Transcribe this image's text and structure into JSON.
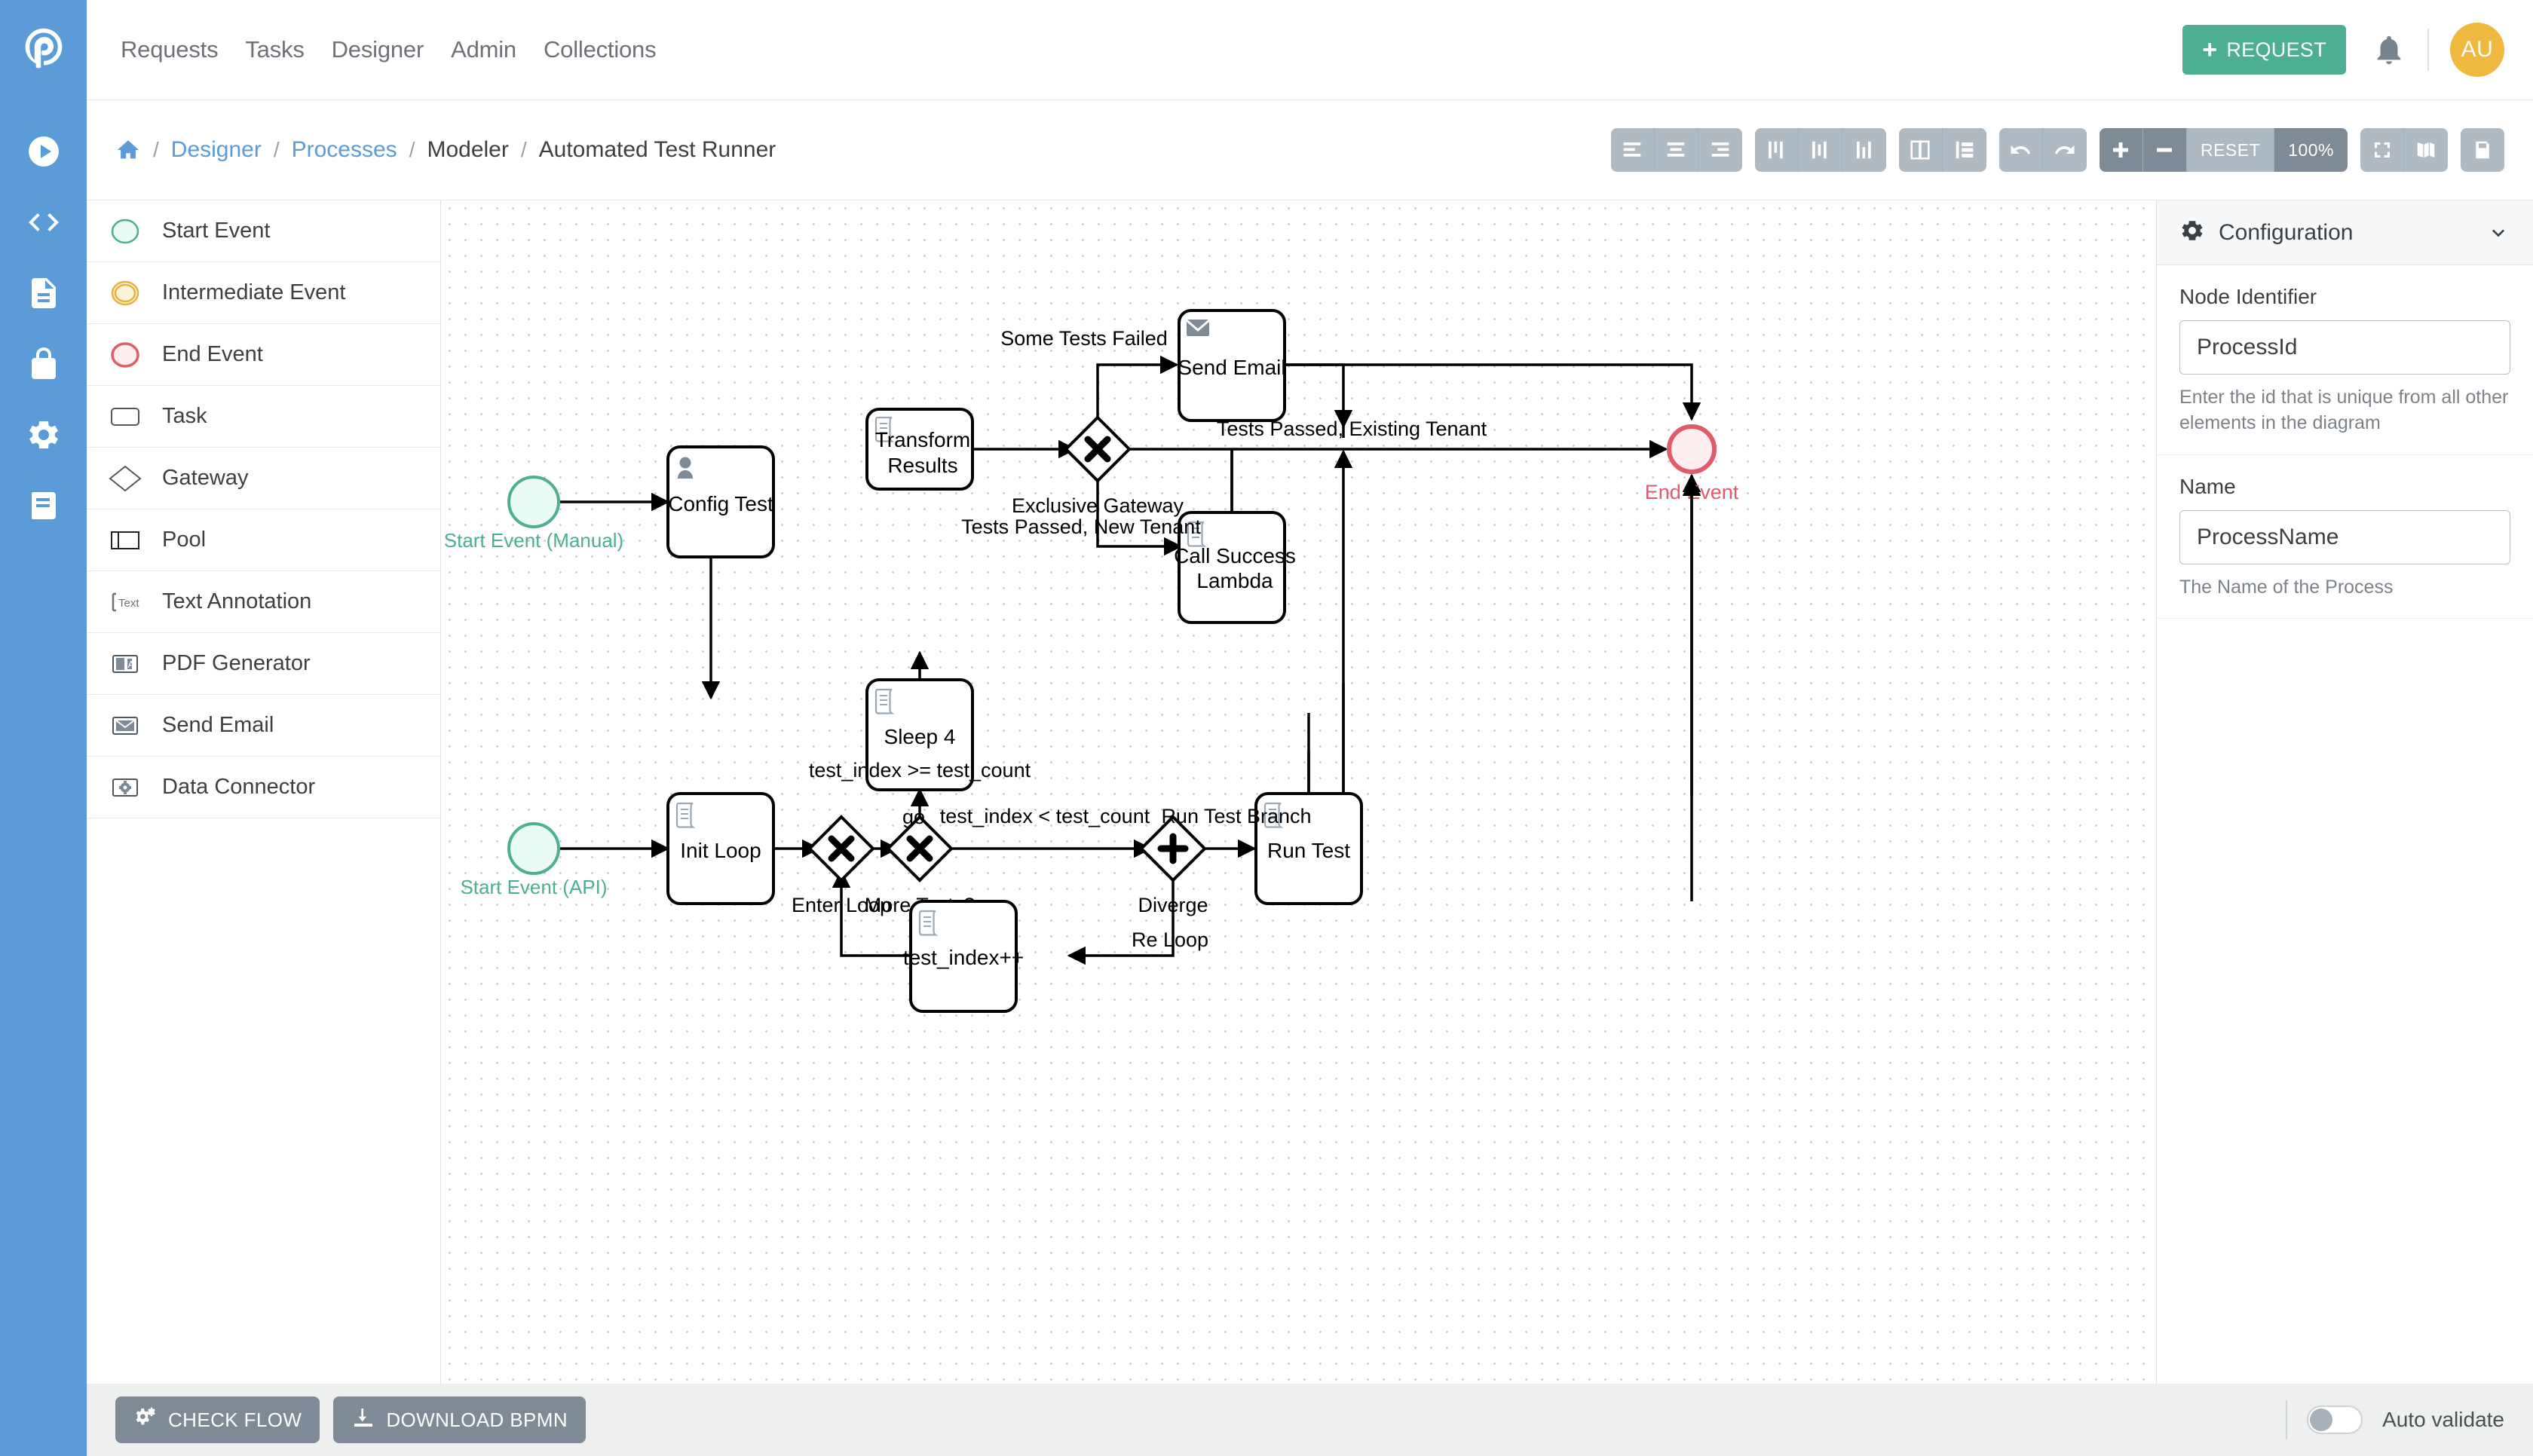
{
  "topnav": {
    "logo_icon": "processmaker-logo-icon",
    "links": [
      "Requests",
      "Tasks",
      "Designer",
      "Admin",
      "Collections"
    ],
    "request_button": "REQUEST",
    "request_plus": "+",
    "bell_icon": "bell-icon",
    "avatar_initials": "AU",
    "accent_blue": "#5a9bd8",
    "accent_green": "#4caf93",
    "avatar_color": "#efb940"
  },
  "rail": {
    "icons": [
      "play-circle-icon",
      "code-icon",
      "document-icon",
      "lock-icon",
      "gear-icon",
      "book-icon"
    ]
  },
  "breadcrumb": {
    "home_icon": "home-icon",
    "separator": "/",
    "items": [
      {
        "label": "Designer",
        "link": true
      },
      {
        "label": "Processes",
        "link": true
      },
      {
        "label": "Modeler",
        "link": false
      },
      {
        "label": "Automated Test Runner",
        "link": false
      }
    ]
  },
  "toolbar": {
    "align_group": [
      "align-left-icon",
      "align-center-icon",
      "align-right-icon"
    ],
    "align_vert_group": [
      "align-top-icon",
      "align-middle-icon",
      "align-bottom-icon"
    ],
    "distribute_group": [
      "distribute-horizontal-icon",
      "distribute-vertical-icon"
    ],
    "history_group": [
      "undo-icon",
      "redo-icon"
    ],
    "zoom_in": "+",
    "zoom_out": "−",
    "reset_label": "RESET",
    "zoom_level": "100%",
    "fit_icon": "fit-screen-icon",
    "minimap_icon": "minimap-icon",
    "save_icon": "save-icon"
  },
  "palette": {
    "items": [
      {
        "label": "Start Event",
        "icon": "start-event-icon"
      },
      {
        "label": "Intermediate Event",
        "icon": "intermediate-event-icon"
      },
      {
        "label": "End Event",
        "icon": "end-event-icon"
      },
      {
        "label": "Task",
        "icon": "task-icon"
      },
      {
        "label": "Gateway",
        "icon": "gateway-icon"
      },
      {
        "label": "Pool",
        "icon": "pool-icon"
      },
      {
        "label": "Text Annotation",
        "icon": "text-annotation-icon"
      },
      {
        "label": "PDF Generator",
        "icon": "pdf-generator-icon"
      },
      {
        "label": "Send Email",
        "icon": "send-email-icon"
      },
      {
        "label": "Data Connector",
        "icon": "data-connector-icon"
      }
    ]
  },
  "diagram": {
    "nodes": [
      {
        "id": "start_manual",
        "type": "start-event",
        "label": "Start Event (Manual)"
      },
      {
        "id": "start_api",
        "type": "start-event",
        "label": "Start Event (API)"
      },
      {
        "id": "config_test",
        "type": "user-task",
        "label": "Config Test"
      },
      {
        "id": "init_loop",
        "type": "script-task",
        "label": "Init Loop"
      },
      {
        "id": "enter_loop",
        "type": "exclusive-gateway",
        "label": "Enter Loop"
      },
      {
        "id": "more_tests",
        "type": "exclusive-gateway",
        "label": "More Tests?"
      },
      {
        "id": "diverge",
        "type": "parallel-gateway",
        "label": "Diverge"
      },
      {
        "id": "run_test",
        "type": "script-task",
        "label": "Run Test"
      },
      {
        "id": "test_index_inc",
        "type": "script-task",
        "label": "test_index++"
      },
      {
        "id": "sleep4",
        "type": "script-task",
        "label": "Sleep 4"
      },
      {
        "id": "transform_results",
        "type": "script-task",
        "label": "Transform Results"
      },
      {
        "id": "exclusive_gateway",
        "type": "exclusive-gateway",
        "label": "Exclusive Gateway"
      },
      {
        "id": "send_email",
        "type": "email-task",
        "label": "Send Email"
      },
      {
        "id": "call_success_lambda",
        "type": "script-task",
        "label": "Call Success Lambda"
      },
      {
        "id": "end_event",
        "type": "end-event",
        "label": "End Event"
      }
    ],
    "edge_labels": [
      "go",
      "test_index < test_count",
      "test_index >= test_count",
      "Run Test Branch",
      "Re Loop",
      "Some Tests Failed",
      "Tests Passed, Existing Tenant",
      "Tests Passed, New Tenant"
    ],
    "node_text": {
      "start_manual": "Start Event (Manual)",
      "start_api": "Start Event (API)",
      "config_test": "Config Test",
      "init_loop": "Init Loop",
      "enter_loop": "Enter Loop",
      "more_tests": "More Tests?",
      "diverge": "Diverge",
      "run_test": "Run Test",
      "test_index_inc": "test_index++",
      "sleep4": "Sleep 4",
      "transform_l1": "Transform",
      "transform_l2": "Results",
      "exclusive_gateway": "Exclusive Gateway",
      "send_email": "Send Email",
      "lambda_l1": "Call Success",
      "lambda_l2": "Lambda",
      "end_event": "End Event"
    },
    "labels": {
      "go": "go",
      "test_index_lt": "test_index < test_count",
      "test_index_gte": "test_index >= test_count",
      "run_test_branch": "Run Test Branch",
      "re_loop": "Re Loop",
      "some_tests_failed": "Some Tests Failed",
      "tests_passed_existing": "Tests Passed, Existing Tenant",
      "tests_passed_new": "Tests Passed, New Tenant"
    },
    "colors": {
      "start_event_stroke": "#4caf93",
      "start_event_fill": "#eafaf4",
      "end_event_stroke": "#e05c6a",
      "end_event_fill": "#fdeef0",
      "intermediate_stroke": "#e8b33c",
      "intermediate_fill": "#fdf3da",
      "task_stroke": "#000000",
      "flow_stroke": "#000000"
    }
  },
  "config_panel": {
    "title": "Configuration",
    "gear_icon": "gear-icon",
    "collapse_icon": "chevron-down-icon",
    "fields": [
      {
        "label": "Node Identifier",
        "value": "ProcessId",
        "help": "Enter the id that is unique from all other elements in the diagram"
      },
      {
        "label": "Name",
        "value": "ProcessName",
        "help": "The Name of the Process"
      }
    ]
  },
  "bottombar": {
    "check_flow": "CHECK FLOW",
    "check_flow_icon": "cogs-icon",
    "download_bpmn": "DOWNLOAD BPMN",
    "download_icon": "download-icon",
    "auto_validate": "Auto validate",
    "auto_validate_on": false
  }
}
